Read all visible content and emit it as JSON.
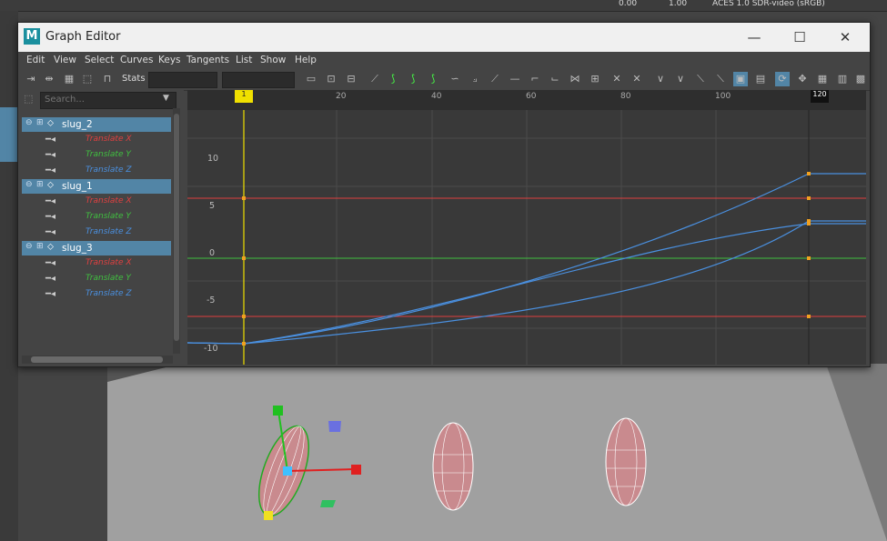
{
  "window": {
    "title": "Graph Editor",
    "logo": "M"
  },
  "window_controls": {
    "minimize": "—",
    "maximize": "☐",
    "close": "✕"
  },
  "menu": [
    "Edit",
    "View",
    "Select",
    "Curves",
    "Keys",
    "Tangents",
    "List",
    "Show",
    "Help"
  ],
  "toolbar": {
    "stats_label": "Stats"
  },
  "outliner": {
    "search_placeholder": "Search...",
    "nodes": [
      {
        "name": "slug_2",
        "attrs": [
          "Translate X",
          "Translate Y",
          "Translate Z"
        ]
      },
      {
        "name": "slug_1",
        "attrs": [
          "Translate X",
          "Translate Y",
          "Translate Z"
        ]
      },
      {
        "name": "slug_3",
        "attrs": [
          "Translate X",
          "Translate Y",
          "Translate Z"
        ]
      }
    ]
  },
  "timeline": {
    "ticks": [
      "20",
      "40",
      "60",
      "80",
      "100"
    ],
    "current_frame": "1",
    "end_frame": "120"
  },
  "graph_axis": {
    "y_labels": [
      "10",
      "5",
      "0",
      "-5",
      "-10"
    ]
  },
  "viewer": {
    "color_space": "ACES 1.0 SDR-video (sRGB)",
    "exposure": "0.00",
    "gamma": "1.00"
  },
  "colors": {
    "x_axis": "#e04040",
    "y_axis": "#40c040",
    "z_axis": "#4a90e0",
    "selection": "#5285a6",
    "time_cursor": "#f0e000",
    "key": "#f0a020"
  }
}
